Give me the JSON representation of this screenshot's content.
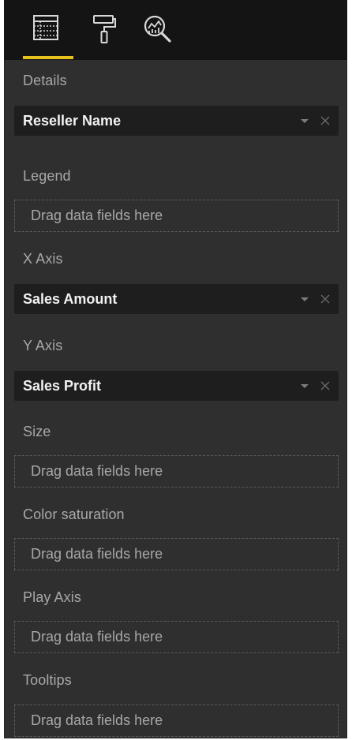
{
  "toolbar": {
    "tabs": [
      {
        "name": "fields",
        "icon": "fields-icon",
        "active": true
      },
      {
        "name": "format",
        "icon": "paint-roller-icon",
        "active": false
      },
      {
        "name": "analytics",
        "icon": "analytics-magnifier-icon",
        "active": false
      }
    ],
    "accent_color": "#e8c11c"
  },
  "wells": {
    "details": {
      "label": "Details",
      "field": "Reseller Name"
    },
    "legend": {
      "label": "Legend",
      "placeholder": "Drag data fields here"
    },
    "x_axis": {
      "label": "X Axis",
      "field": "Sales Amount"
    },
    "y_axis": {
      "label": "Y Axis",
      "field": "Sales Profit"
    },
    "size": {
      "label": "Size",
      "placeholder": "Drag data fields here"
    },
    "color_saturation": {
      "label": "Color saturation",
      "placeholder": "Drag data fields here"
    },
    "play_axis": {
      "label": "Play Axis",
      "placeholder": "Drag data fields here"
    },
    "tooltips": {
      "label": "Tooltips",
      "placeholder": "Drag data fields here"
    }
  },
  "colors": {
    "panel_bg": "#2f2f2f",
    "toolbar_bg": "#141414",
    "chip_bg": "#1e1e1e",
    "label_text": "#a8a8a8",
    "chip_text": "#f2f2f2"
  }
}
